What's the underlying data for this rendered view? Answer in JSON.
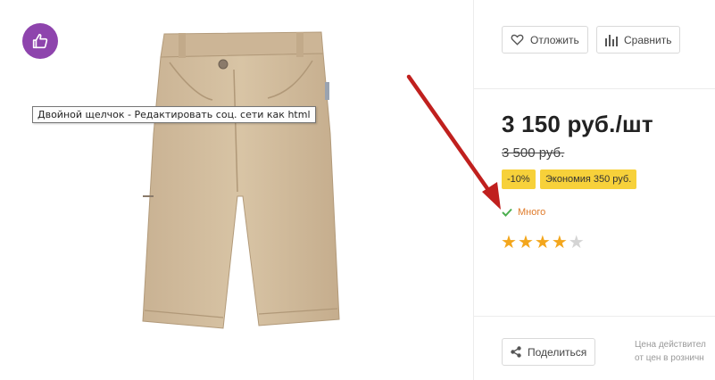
{
  "tooltip": {
    "text": "Двойной щелчок - Редактировать соц. сети как html"
  },
  "icons": {
    "social": "thumbs-up-icon",
    "wishlist": "heart-icon",
    "compare": "bar-chart-icon",
    "share": "share-icon",
    "stock": "check-icon"
  },
  "colors": {
    "social_badge": "#8e44ad",
    "discount_badge": "#f7d13a",
    "stock_text": "#e07b2a",
    "star_on": "#f3a61c",
    "star_off": "#d4d4d4",
    "arrow": "#c0201e",
    "check": "#4caf50"
  },
  "actions": {
    "wishlist_label": "Отложить",
    "compare_label": "Сравнить",
    "share_label": "Поделиться"
  },
  "product": {
    "price": "3 150 руб./шт",
    "old_price": "3 500 руб.",
    "discount_badge": "-10%",
    "savings_badge": "Экономия 350 руб.",
    "stock_label": "Много",
    "rating": 4,
    "rating_max": 5
  },
  "note": {
    "line1": "Цена действител",
    "line2": "от цен в розничн"
  }
}
